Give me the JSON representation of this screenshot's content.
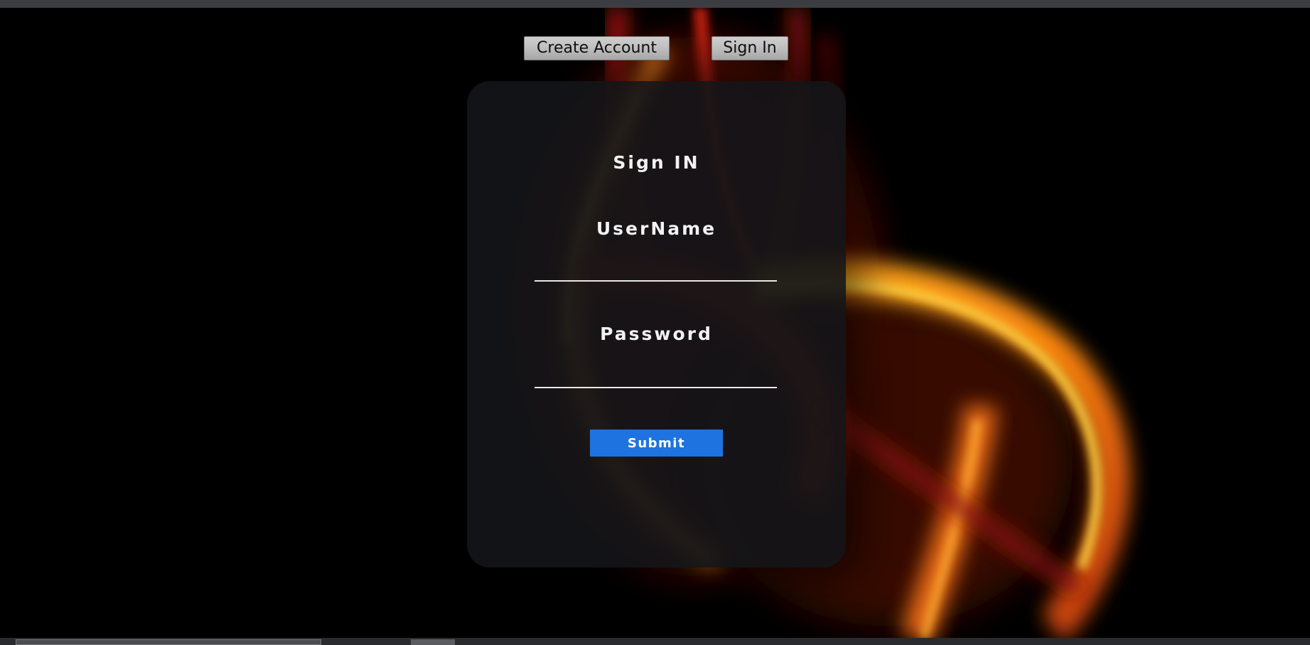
{
  "nav": {
    "create_account_label": "Create Account",
    "sign_in_label": "Sign In"
  },
  "form": {
    "title": "Sign IN",
    "username_label": "UserName",
    "username_value": "",
    "password_label": "Password",
    "password_value": "",
    "submit_label": "Submit"
  },
  "colors": {
    "page_background": "#000000",
    "card_background": "#121418",
    "submit_button": "#1f73e0",
    "nav_button": "#dadada",
    "flame_orange": "#ff9a1a",
    "flame_red": "#a0180c"
  }
}
